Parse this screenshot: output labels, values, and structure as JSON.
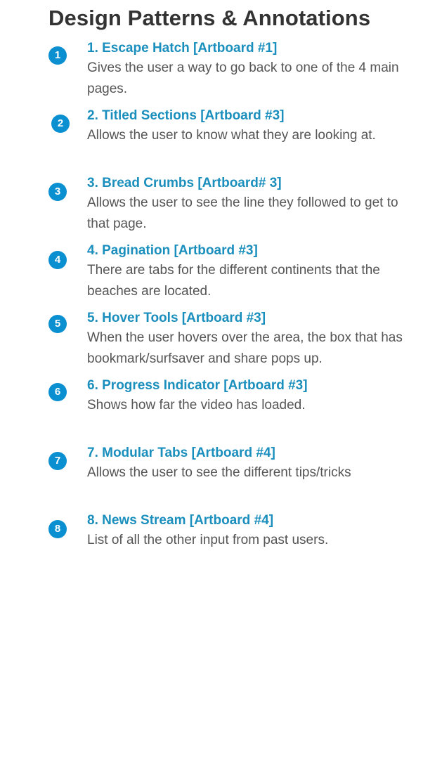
{
  "page": {
    "title": "Design Patterns & Annotations"
  },
  "annotations": [
    {
      "number": "1",
      "title": "1. Escape Hatch [Artboard #1]",
      "description": "Gives the user a way to go back to one of the 4 main pages."
    },
    {
      "number": "2",
      "title": "2. Titled Sections [Artboard #3]",
      "description": "Allows the user to know what they are looking at."
    },
    {
      "number": "3",
      "title": "3. Bread Crumbs [Artboard# 3]",
      "description": "Allows the user to see the line they followed to get to that page."
    },
    {
      "number": "4",
      "title": "4. Pagination [Artboard #3]",
      "description": "There are tabs for the different continents that the beaches are located."
    },
    {
      "number": "5",
      "title": "5. Hover Tools [Artboard #3]",
      "description": "When the user hovers over the area, the box that has bookmark/surfsaver and share pops up."
    },
    {
      "number": "6",
      "title": "6. Progress Indicator [Artboard #3]",
      "description": "Shows how far the video has loaded."
    },
    {
      "number": "7",
      "title": "7. Modular Tabs [Artboard #4]",
      "description": "Allows the user to see the different tips/tricks"
    },
    {
      "number": "8",
      "title": "8. News Stream [Artboard #4]",
      "description": "List of all the other input from past users."
    }
  ],
  "colors": {
    "marker": "#0a8fd0",
    "item_title": "#1a8fbd",
    "page_title": "#333333",
    "description": "#555555"
  }
}
